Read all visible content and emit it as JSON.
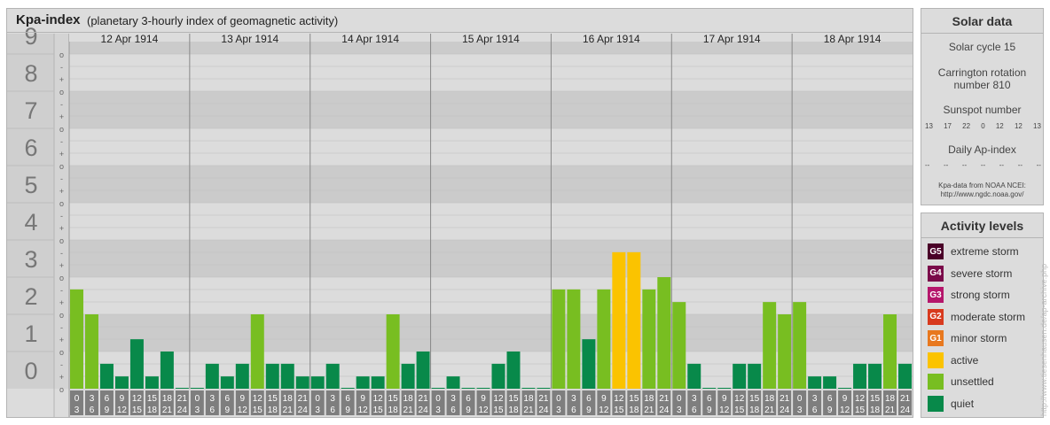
{
  "header": {
    "title": "Kpa-index",
    "subtitle": "(planetary 3-hourly index of geomagnetic activity)"
  },
  "chart_data": {
    "type": "bar",
    "title": "Kpa-index",
    "subtitle": "(planetary 3-hourly index of geomagnetic activity)",
    "y_ticks": [
      "0",
      "1",
      "2",
      "3",
      "4",
      "5",
      "6",
      "7",
      "8",
      "9"
    ],
    "y_subticks": [
      "-",
      "o",
      "+"
    ],
    "ylim": [
      0,
      9.33
    ],
    "days": [
      "12 Apr 1914",
      "13 Apr 1914",
      "14 Apr 1914",
      "15 Apr 1914",
      "16 Apr 1914",
      "17 Apr 1914",
      "18 Apr 1914"
    ],
    "interval_labels": [
      [
        "0",
        "3"
      ],
      [
        "3",
        "6"
      ],
      [
        "6",
        "9"
      ],
      [
        "9",
        "12"
      ],
      [
        "12",
        "15"
      ],
      [
        "15",
        "18"
      ],
      [
        "18",
        "21"
      ],
      [
        "21",
        "24"
      ]
    ],
    "values": [
      [
        2.67,
        2.0,
        0.67,
        0.33,
        1.33,
        0.33,
        1.0,
        0
      ],
      [
        0,
        0.67,
        0.33,
        0.67,
        2.0,
        0.67,
        0.67,
        0.33
      ],
      [
        0.33,
        0.67,
        0,
        0.33,
        0.33,
        2.0,
        0.67,
        1.0
      ],
      [
        0,
        0.33,
        0,
        0,
        0.67,
        1.0,
        0,
        0
      ],
      [
        2.67,
        2.67,
        1.33,
        2.67,
        3.67,
        3.67,
        2.67,
        3.0
      ],
      [
        2.33,
        0.67,
        0,
        0,
        0.67,
        0.67,
        2.33,
        2.0
      ],
      [
        2.33,
        0.33,
        0.33,
        0,
        0.67,
        0.67,
        2.0,
        0.67
      ]
    ],
    "level_colors": {
      "quiet": "#08894a",
      "unsettled": "#78be21",
      "active": "#fbc300"
    },
    "grid": true
  },
  "solar": {
    "title": "Solar data",
    "cycle": "Solar cycle 15",
    "rotation_line1": "Carrington rotation",
    "rotation_line2": "number 810",
    "sunspot_title": "Sunspot number",
    "sunspots": [
      "13",
      "17",
      "22",
      "0",
      "12",
      "12",
      "13"
    ],
    "ap_title": "Daily Ap-index",
    "ap_values": [
      "--",
      "--",
      "--",
      "--",
      "--",
      "--",
      "--"
    ],
    "note_line1": "Kpa-data from NOAA NCEI:",
    "note_line2": "http://www.ngdc.noaa.gov/"
  },
  "levels": {
    "title": "Activity levels",
    "items": [
      {
        "code": "G5",
        "label": "extreme storm",
        "color": "#4a0028"
      },
      {
        "code": "G4",
        "label": "severe storm",
        "color": "#7a0a4a"
      },
      {
        "code": "G3",
        "label": "strong storm",
        "color": "#b5166b"
      },
      {
        "code": "G2",
        "label": "moderate storm",
        "color": "#d83a1e"
      },
      {
        "code": "G1",
        "label": "minor storm",
        "color": "#e8781e"
      },
      {
        "code": "",
        "label": "active",
        "color": "#fbc300"
      },
      {
        "code": "",
        "label": "unsettled",
        "color": "#78be21"
      },
      {
        "code": "",
        "label": "quiet",
        "color": "#08894a"
      }
    ]
  },
  "side_url": "http://www.tiesenhausen.de/ap-archive.php"
}
